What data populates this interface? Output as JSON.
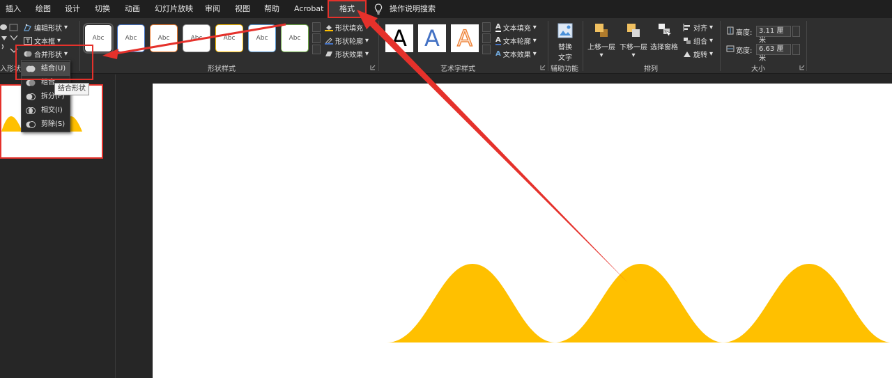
{
  "tabs": [
    "插入",
    "绘图",
    "设计",
    "切换",
    "动画",
    "幻灯片放映",
    "审阅",
    "视图",
    "帮助",
    "Acrobat",
    "格式"
  ],
  "active_tab": "格式",
  "search_label": "操作说明搜索",
  "insert_shapes": {
    "edit_shape": "编辑形状",
    "text_box": "文本框",
    "merge_shapes": "合并形状",
    "group_label": "入形状"
  },
  "shape_styles": {
    "sample_text": "Abc",
    "outline_colors": [
      "#222222",
      "#4472c4",
      "#ed7d31",
      "#a5a5a5",
      "#ffc000",
      "#5b9bd5",
      "#70ad47"
    ],
    "fill_label": "形状填充",
    "outline_label": "形状轮廓",
    "effects_label": "形状效果",
    "group_label": "形状样式"
  },
  "wordart": {
    "letter": "A",
    "text_fill": "文本填充",
    "text_outline": "文本轮廓",
    "text_effects": "文本效果",
    "group_label": "艺术字样式"
  },
  "accessibility": {
    "alt_text_line1": "替换",
    "alt_text_line2": "文字",
    "group_label": "辅助功能"
  },
  "arrange": {
    "bring_forward": "上移一层",
    "send_backward": "下移一层",
    "selection_pane": "选择窗格",
    "align": "对齐",
    "group": "组合",
    "rotate": "旋转",
    "group_label": "排列"
  },
  "size": {
    "height_label": "高度:",
    "height_value": "3.11 厘米",
    "width_label": "宽度:",
    "width_value": "6.63 厘米",
    "group_label": "大小"
  },
  "merge_menu": {
    "items": [
      "结合(U)",
      "组合",
      "拆分(F)",
      "相交(I)",
      "剪除(S)"
    ],
    "tooltip": "结合形状"
  },
  "colors": {
    "accent_red": "#e5312b",
    "shape_yellow": "#ffc000"
  }
}
